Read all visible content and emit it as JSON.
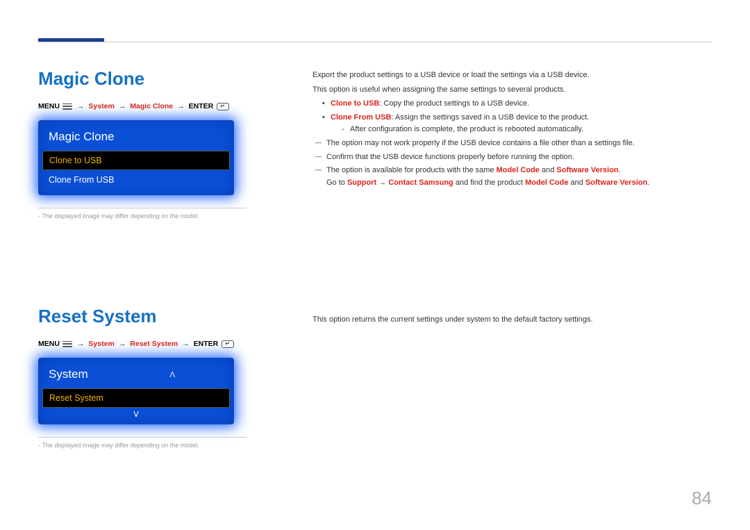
{
  "page_number": "84",
  "section1": {
    "heading": "Magic Clone",
    "breadcrumb": {
      "menu": "MENU",
      "step1": "System",
      "step2": "Magic Clone",
      "enter": "ENTER"
    },
    "menu": {
      "title": "Magic Clone",
      "item_selected": "Clone to USB",
      "item2": "Clone From USB"
    },
    "disclaimer": "The displayed image may differ depending on the model.",
    "desc": {
      "p1": "Export the product settings to a USB device or load the settings via a USB device.",
      "p2": "This option is useful when assigning the same settings to several products.",
      "b1_label": "Clone to USB",
      "b1_text": ": Copy the product settings to a USB device.",
      "b2_label": "Clone From USB",
      "b2_text": ": Assign the settings saved in a USB device to the product.",
      "sub1": "After configuration is complete, the product is rebooted automatically.",
      "dash1": "The option may not work properly if the USB device contains a file other than a settings file.",
      "dash2": "Confirm that the USB device functions properly before running the option.",
      "dash3_a": "The option is available for products with the same ",
      "dash3_mc": "Model Code",
      "dash3_and": " and ",
      "dash3_sv": "Software Version",
      "dash3_end": ".",
      "dash3_line2_a": "Go to ",
      "dash3_support": "Support",
      "dash3_arrow": " → ",
      "dash3_contact": "Contact Samsung",
      "dash3_line2_b": " and find the product ",
      "dash3_mc2": "Model Code",
      "dash3_and2": " and ",
      "dash3_sv2": "Software Version",
      "dash3_end2": "."
    }
  },
  "section2": {
    "heading": "Reset System",
    "breadcrumb": {
      "menu": "MENU",
      "step1": "System",
      "step2": "Reset System",
      "enter": "ENTER"
    },
    "menu": {
      "title": "System",
      "item_selected": "Reset System"
    },
    "disclaimer": "The displayed image may differ depending on the model.",
    "desc": "This option returns the current settings under system to the default factory settings."
  }
}
